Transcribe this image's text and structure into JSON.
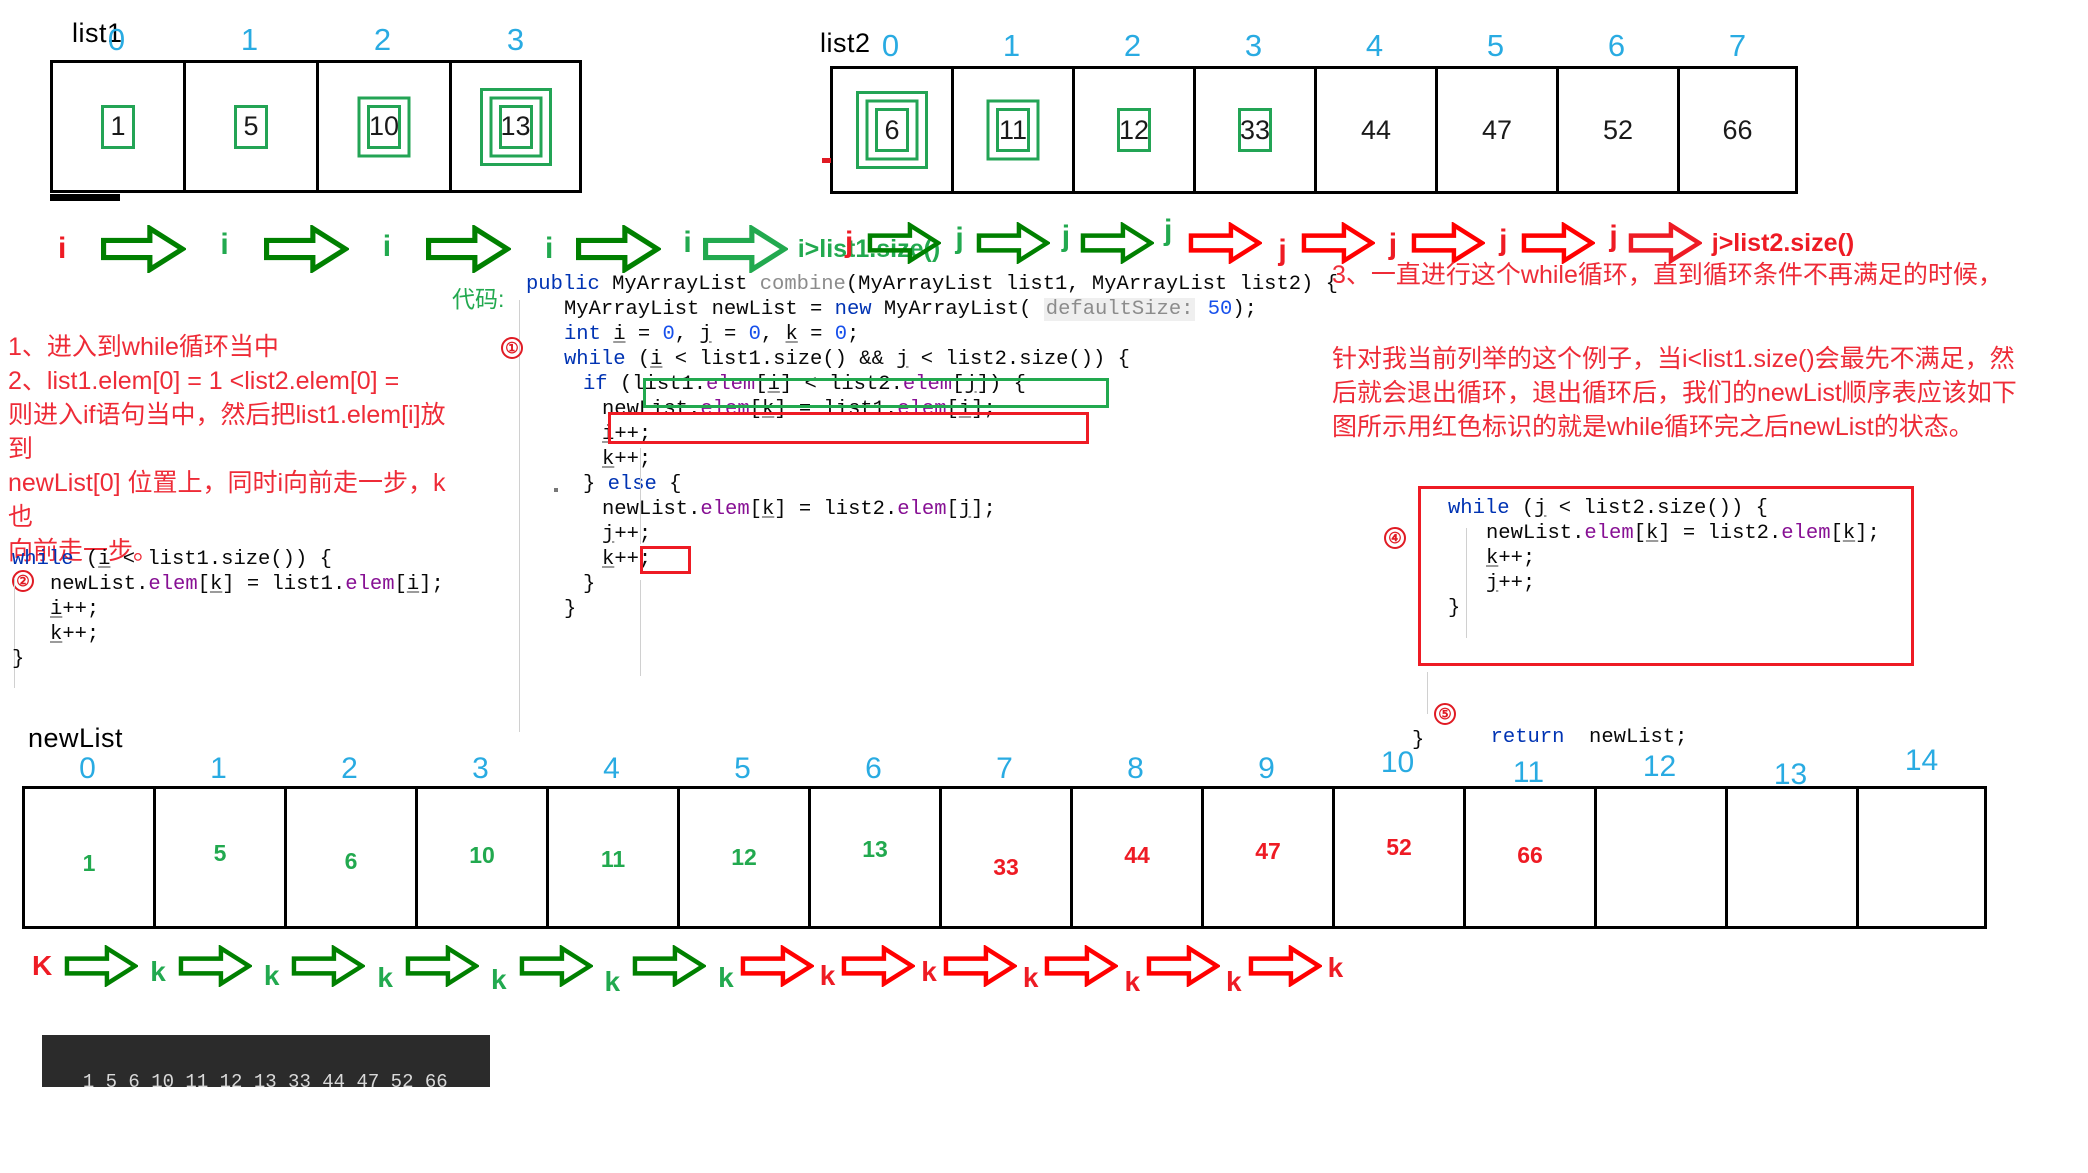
{
  "list1": {
    "label": "list1",
    "indices": [
      "0",
      "1",
      "2",
      "3"
    ],
    "values": [
      "1",
      "5",
      "10",
      "13"
    ],
    "rings": [
      1,
      1,
      2,
      3
    ]
  },
  "list2": {
    "label": "list2",
    "indices": [
      "0",
      "1",
      "2",
      "3",
      "4",
      "5",
      "6",
      "7"
    ],
    "values": [
      "6",
      "11",
      "12",
      "33",
      "44",
      "47",
      "52",
      "66"
    ],
    "rings": [
      3,
      2,
      1,
      1,
      0,
      0,
      0,
      0
    ]
  },
  "newlist": {
    "label": "newList",
    "indices": [
      "0",
      "1",
      "2",
      "3",
      "4",
      "5",
      "6",
      "7",
      "8",
      "9",
      "10",
      "11",
      "12",
      "13",
      "14"
    ],
    "values": [
      "1",
      "5",
      "6",
      "10",
      "11",
      "12",
      "13",
      "33",
      "44",
      "47",
      "52",
      "66",
      "",
      "",
      ""
    ],
    "value_colors": [
      "green",
      "green",
      "green",
      "green",
      "green",
      "green",
      "green",
      "red",
      "red",
      "red",
      "red",
      "red",
      "",
      "",
      ""
    ]
  },
  "i_track": {
    "pointers": [
      "i",
      "i",
      "i",
      "i",
      "i"
    ],
    "pointer_colors": [
      "red",
      "green",
      "green",
      "green",
      "green"
    ],
    "end_condition": "i>list1.size()",
    "end_condition_color": "green"
  },
  "j_track": {
    "pointers": [
      "j",
      "j",
      "j",
      "j",
      "j",
      "j",
      "j",
      "j"
    ],
    "pointer_colors": [
      "red",
      "green",
      "green",
      "green",
      "red",
      "red",
      "red",
      "red"
    ],
    "arrow_colors": [
      "green",
      "green",
      "green",
      "red",
      "red",
      "red",
      "red"
    ],
    "end_condition": "j>list2.size()",
    "end_condition_color": "red"
  },
  "k_track": {
    "pointers": [
      "K",
      "k",
      "k",
      "k",
      "k",
      "k",
      "k",
      "k",
      "k",
      "k",
      "k",
      "k",
      "k"
    ],
    "pointer_colors": [
      "red",
      "green",
      "green",
      "green",
      "green",
      "green",
      "green",
      "red",
      "red",
      "red",
      "red",
      "red",
      "red"
    ],
    "arrow_colors": [
      "green",
      "green",
      "green",
      "green",
      "green",
      "green",
      "red",
      "red",
      "red",
      "red",
      "red",
      "red"
    ]
  },
  "code_label": "代码:",
  "main_code": {
    "markers": [
      "①"
    ],
    "signature": "public MyArrayList combine(MyArrayList list1, MyArrayList list2) {",
    "lines": [
      "MyArrayList newList = new MyArrayList( defaultSize: 50);",
      "int i = 0, j = 0, k = 0;",
      "while (i < list1.size() && j < list2.size()) {",
      "if (list1.elem[i] < list2.elem[j]) {",
      "newList.elem[k] = list1.elem[i];",
      "i++;",
      "k++;",
      "} else {",
      "newList.elem[k] = list2.elem[j];",
      "j++;",
      "k++;",
      "}",
      "}"
    ],
    "default_size_hint": "defaultSize:",
    "default_size_value": "50"
  },
  "code_block_2": {
    "marker": "②",
    "lines": [
      "while (i < list1.size()) {",
      "    newList.elem[k] = list1.elem[i];",
      "    i++;",
      "    k++;",
      "}"
    ]
  },
  "code_block_4": {
    "marker": "④",
    "lines": [
      "while (j < list2.size()) {",
      "    newList.elem[k] = list2.elem[k];",
      "    k++;",
      "    j++;",
      "}"
    ]
  },
  "code_block_5": {
    "marker": "⑤",
    "line": "return newList;",
    "closing_brace": "}"
  },
  "note_left": "1、进入到while循环当中\n2、list1.elem[0] = 1 <list2.elem[0] =\n则进入if语句当中，然后把list1.elem[i]放到\nnewList[0] 位置上，同时i向前走一步，k也\n向前走一步。",
  "note_right": "3、一直进行这个while循环，直到循环条件不再满足的时候，",
  "note_right2": "针对我当前列举的这个例子，当i<list1.size()会最先不满足，然\n后就会退出循环，退出循环后，我们的newList顺序表应该如下\n图所示用红色标识的就是while循环完之后newList的状态。",
  "terminal": {
    "output": "1 5 6 10 11 12 13 33 44 47 52 66"
  },
  "colors": {
    "index_blue": "#29abe2",
    "green": "#22a94f",
    "red": "#ee1b24",
    "note_red": "#ee2b37",
    "black": "#000000",
    "terminal_bg": "#2b2b2b"
  }
}
